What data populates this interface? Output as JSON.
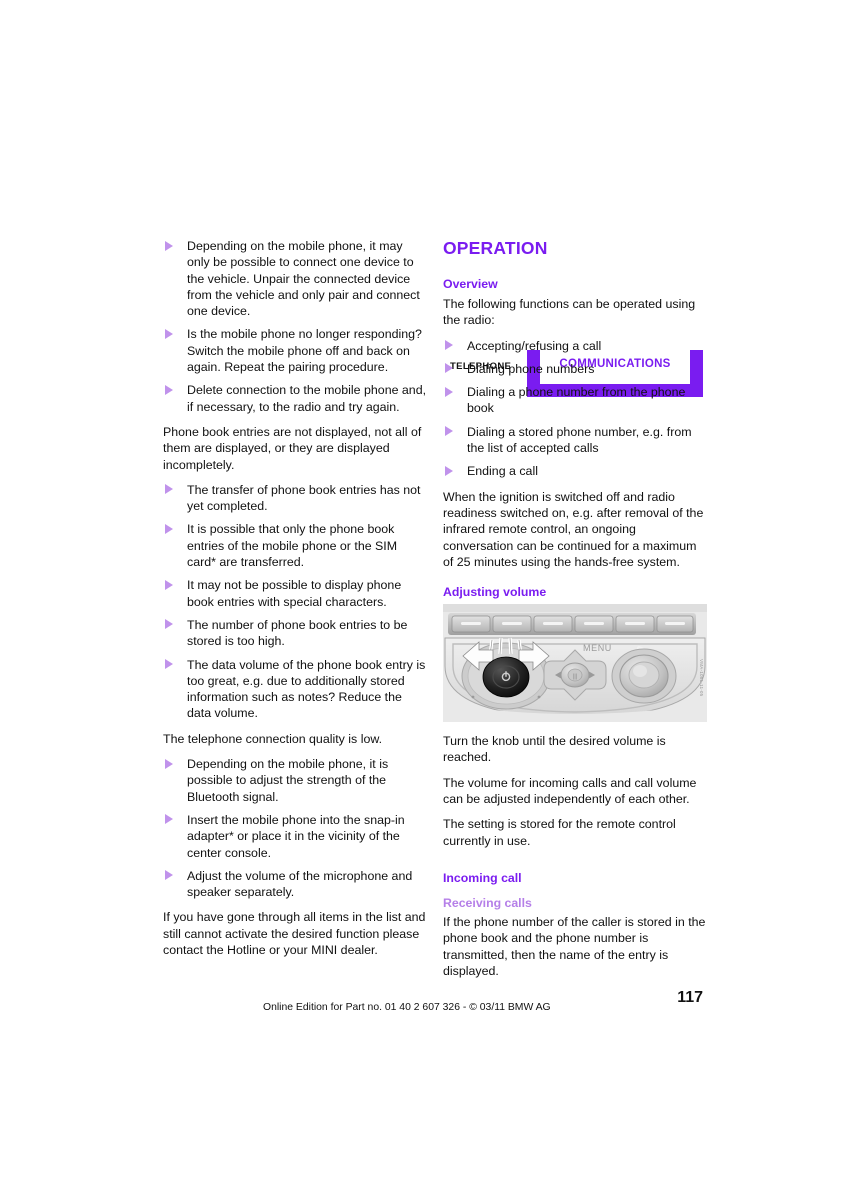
{
  "header": {
    "section_label": "TELEPHONE",
    "tab_label": "COMMUNICATIONS",
    "brand_color": "#7a1cf0",
    "brand_light_color": "#b57fe8"
  },
  "left_column": {
    "bullets_top": [
      "Depending on the mobile phone, it may only be possible to connect one device to the vehicle. Unpair the connected device from the vehicle and only pair and connect one device.",
      "Is the mobile phone no longer responding? Switch the mobile phone off and back on again. Repeat the pairing procedure.",
      "Delete connection to the mobile phone and, if necessary, to the radio and try again."
    ],
    "para_phonebook": "Phone book entries are not displayed, not all of them are displayed, or they are displayed incompletely.",
    "bullets_phonebook": [
      "The transfer of phone book entries has not yet completed.",
      "It is possible that only the phone book entries of the mobile phone or the SIM card* are transferred.",
      "It may not be possible to display phone book entries with special characters.",
      "The number of phone book entries to be stored is too high.",
      "The data volume of the phone book entry is too great, e.g. due to additionally stored information such as notes? Reduce the data volume."
    ],
    "para_quality": "The telephone connection quality is low.",
    "bullets_quality": [
      "Depending on the mobile phone, it is possible to adjust the strength of the Bluetooth signal.",
      "Insert the mobile phone into the snap-in adapter* or place it in the vicinity of the center console.",
      "Adjust the volume of the microphone and speaker separately."
    ],
    "para_hotline": "If you have gone through all items in the list and still cannot activate the desired function please contact the Hotline or your MINI dealer."
  },
  "right_column": {
    "section_title": "OPERATION",
    "overview_title": "Overview",
    "overview_intro": "The following functions can be operated using the radio:",
    "overview_bullets": [
      "Accepting/refusing a call",
      "Dialing phone numbers",
      "Dialing a phone number from the phone book",
      "Dialing a stored phone number, e.g. from the list of accepted calls",
      "Ending a call"
    ],
    "ignition_para": "When the ignition is switched off and radio readiness switched on, e.g. after removal of the infrared remote control, an ongoing conversation can be continued for a maximum of 25 minutes using the hands-free system.",
    "adjusting_volume_title": "Adjusting volume",
    "figure": {
      "name": "radio-control-panel-illustration",
      "knob_glyph": "⏻",
      "menu_label": "MENU",
      "caption": "VMA-1081-11-05"
    },
    "volume_paras": [
      "Turn the knob until the desired volume is reached.",
      "The volume for incoming calls and call volume can be adjusted independently of each other.",
      "The setting is stored for the remote control currently in use."
    ],
    "incoming_call_title": "Incoming call",
    "receiving_calls_title": "Receiving calls",
    "receiving_calls_para": "If the phone number of the caller is stored in the phone book and the phone number is transmitted, then the name of the entry is displayed."
  },
  "footer": {
    "text": "Online Edition for Part no. 01 40 2 607 326 - © 03/11 BMW AG",
    "page_number": "117"
  }
}
